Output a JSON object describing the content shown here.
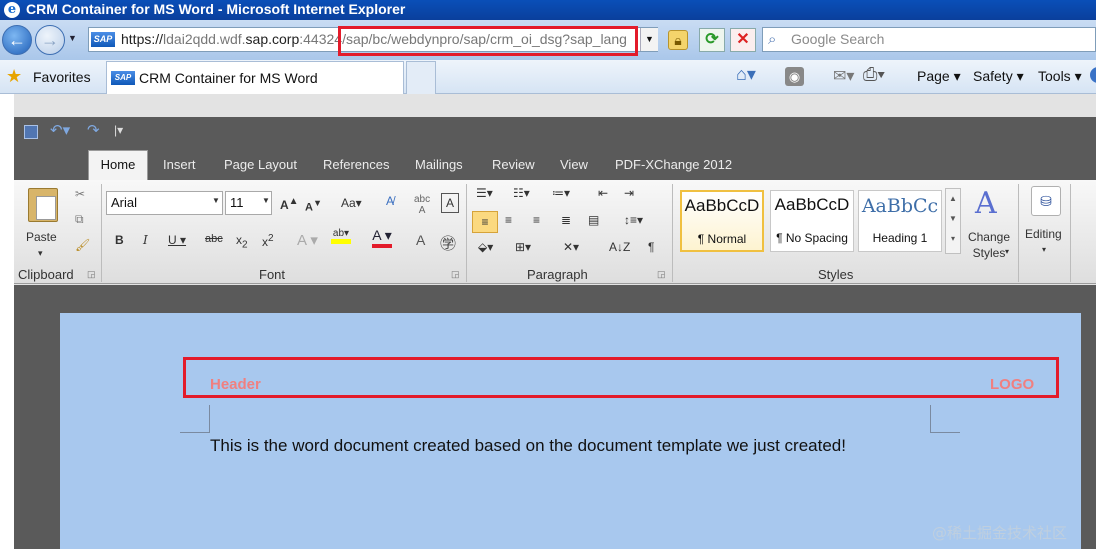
{
  "window": {
    "title": "CRM Container for MS Word - Microsoft Internet Explorer"
  },
  "nav": {
    "address_prefix": "https://",
    "address_host_dim": "ldai2qdd.wdf.",
    "address_host": "sap.corp",
    "address_path": ":44324/sap/bc/webdynpro/sap/crm_oi_dsg?sap_lang",
    "search_placeholder": "Google Search",
    "favicon_text": "SAP"
  },
  "favorites_bar": {
    "favorites_label": "Favorites",
    "tab_label": "CRM Container for MS Word",
    "commands": {
      "page": "Page ▾",
      "safety": "Safety ▾",
      "tools": "Tools ▾"
    }
  },
  "ribbon": {
    "tabs": [
      "Home",
      "Insert",
      "Page Layout",
      "References",
      "Mailings",
      "Review",
      "View",
      "PDF-XChange 2012"
    ],
    "clipboard": {
      "label": "Clipboard",
      "paste": "Paste"
    },
    "font": {
      "label": "Font",
      "family": "Arial",
      "size": "11"
    },
    "paragraph": {
      "label": "Paragraph"
    },
    "styles": {
      "label": "Styles",
      "items": [
        {
          "sample": "AaBbCcD",
          "name": "¶ Normal"
        },
        {
          "sample": "AaBbCcD",
          "name": "¶ No Spacing"
        },
        {
          "sample": "AaBbCc",
          "name": "Heading 1"
        }
      ],
      "change_styles": "Change Styles"
    },
    "editing": {
      "label": "Editing"
    }
  },
  "document": {
    "header_left": "Header",
    "header_right": "LOGO",
    "body": "This is the word document created based on the document template we just created!"
  },
  "watermark": "@稀土掘金技术社区",
  "colors": {
    "highlight": "#e31b2a",
    "page": "#a8c8ee",
    "header_text": "#f08080"
  }
}
